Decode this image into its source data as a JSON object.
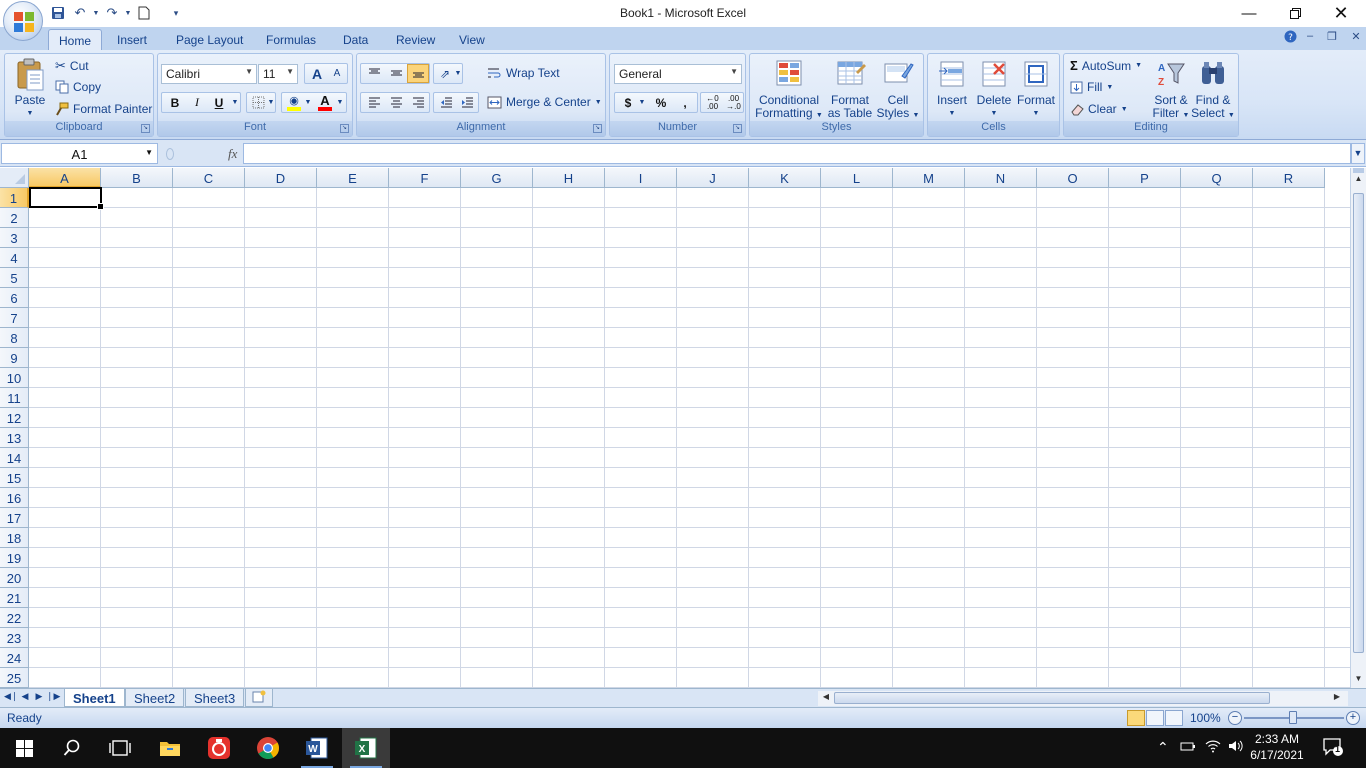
{
  "window": {
    "title": "Book1 - Microsoft Excel",
    "minimize_icon": "minimize-icon",
    "restore_icon": "restore-icon",
    "close_icon": "close-icon"
  },
  "quick_access": [
    "save-icon",
    "undo-icon",
    "redo-icon",
    "new-document-icon",
    "customize-qat-icon"
  ],
  "tabs": [
    {
      "label": "Home",
      "active": true
    },
    {
      "label": "Insert"
    },
    {
      "label": "Page Layout"
    },
    {
      "label": "Formulas"
    },
    {
      "label": "Data"
    },
    {
      "label": "Review"
    },
    {
      "label": "View"
    }
  ],
  "ribbon": {
    "clipboard": {
      "label": "Clipboard",
      "paste": "Paste",
      "cut": "Cut",
      "copy": "Copy",
      "format_painter": "Format Painter"
    },
    "font": {
      "label": "Font",
      "font_name": "Calibri",
      "font_size": "11",
      "bold": "B",
      "italic": "I",
      "underline": "U",
      "grow": "A",
      "shrink": "A",
      "font_color": "#ff0000",
      "fill_color": "#ffff00"
    },
    "alignment": {
      "label": "Alignment",
      "wrap_text": "Wrap Text",
      "merge_center": "Merge & Center"
    },
    "number": {
      "label": "Number",
      "format": "General",
      "currency": "$",
      "percent": "%",
      "comma": ","
    },
    "styles": {
      "label": "Styles",
      "conditional_formatting": [
        "Conditional",
        "Formatting"
      ],
      "format_as_table": [
        "Format",
        "as Table"
      ],
      "cell_styles": [
        "Cell",
        "Styles"
      ]
    },
    "cells": {
      "label": "Cells",
      "insert": "Insert",
      "delete": "Delete",
      "format": "Format"
    },
    "editing": {
      "label": "Editing",
      "autosum": "AutoSum",
      "fill": "Fill",
      "clear": "Clear",
      "sort_filter": [
        "Sort &",
        "Filter"
      ],
      "find_select": [
        "Find &",
        "Select"
      ]
    }
  },
  "formula_bar": {
    "name_box": "A1",
    "fx": "fx",
    "value": ""
  },
  "grid": {
    "columns": [
      "A",
      "B",
      "C",
      "D",
      "E",
      "F",
      "G",
      "H",
      "I",
      "J",
      "K",
      "L",
      "M",
      "N",
      "O",
      "P",
      "Q",
      "R"
    ],
    "rows": [
      "1",
      "2",
      "3",
      "4",
      "5",
      "6",
      "7",
      "8",
      "9",
      "10",
      "11",
      "12",
      "13",
      "14",
      "15",
      "16",
      "17",
      "18",
      "19",
      "20",
      "21",
      "22",
      "23",
      "24",
      "25"
    ],
    "active_cell": "A1"
  },
  "sheets": [
    {
      "label": "Sheet1",
      "active": true
    },
    {
      "label": "Sheet2"
    },
    {
      "label": "Sheet3"
    }
  ],
  "status": {
    "text": "Ready",
    "zoom": "100%",
    "zoom_minus": "−",
    "zoom_plus": "+"
  },
  "taskbar": {
    "time": "2:33 AM",
    "date": "6/17/2021",
    "notification_count": "1",
    "apps": [
      "start-icon",
      "search-icon",
      "task-view-icon",
      "file-explorer-icon",
      "app-icon",
      "chrome-icon",
      "word-icon",
      "excel-icon"
    ]
  }
}
